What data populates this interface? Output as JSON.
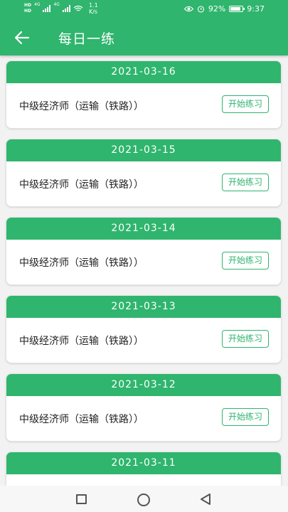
{
  "status_bar": {
    "network_left_top": "HD",
    "network_left_bottom": "HD",
    "signal1_label": "4G",
    "signal2_label": "4G",
    "speed_value": "1.1",
    "speed_unit": "K/s",
    "battery_percent": "92%",
    "battery_level": 0.92,
    "time": "9:37",
    "icons": [
      "eye-icon",
      "alarm-icon",
      "battery-icon",
      "wifi-icon",
      "signal-icon"
    ]
  },
  "header": {
    "title": "每日一练",
    "back_icon": "arrow-left-icon"
  },
  "colors": {
    "primary": "#2fb56d",
    "background": "#f2f2f2",
    "text": "#222222"
  },
  "practice_list": [
    {
      "date": "2021-03-16",
      "subject": "中级经济师（运输（铁路））",
      "button": "开始练习"
    },
    {
      "date": "2021-03-15",
      "subject": "中级经济师（运输（铁路））",
      "button": "开始练习"
    },
    {
      "date": "2021-03-14",
      "subject": "中级经济师（运输（铁路））",
      "button": "开始练习"
    },
    {
      "date": "2021-03-13",
      "subject": "中级经济师（运输（铁路））",
      "button": "开始练习"
    },
    {
      "date": "2021-03-12",
      "subject": "中级经济师（运输（铁路））",
      "button": "开始练习"
    },
    {
      "date": "2021-03-11",
      "subject": "",
      "button": ""
    }
  ],
  "nav_bar": {
    "icons": [
      "recent-apps-icon",
      "home-icon",
      "back-triangle-icon"
    ]
  }
}
